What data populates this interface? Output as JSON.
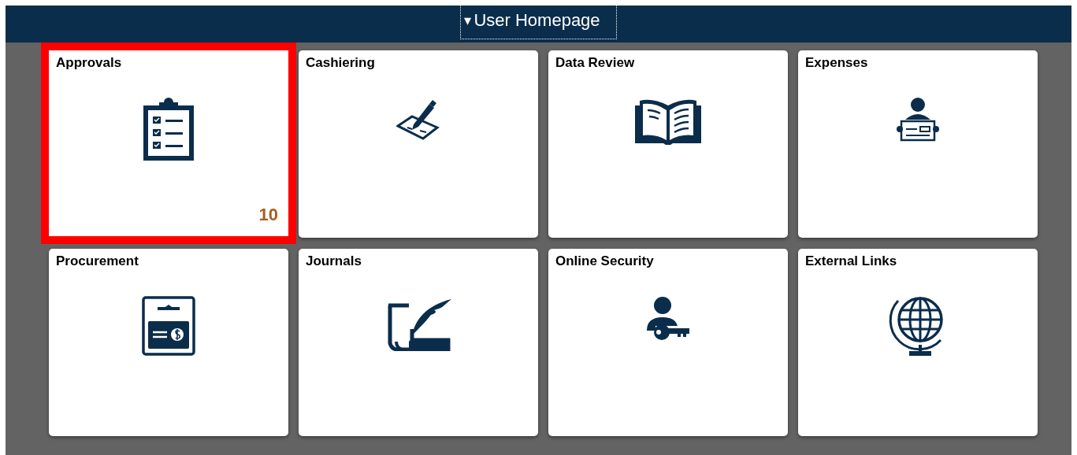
{
  "header": {
    "title": "User Homepage",
    "caret": "▾"
  },
  "tiles": [
    {
      "title": "Approvals",
      "kind": "clipboard",
      "badge": "10",
      "highlighted": true
    },
    {
      "title": "Cashiering",
      "kind": "signing",
      "highlighted": false
    },
    {
      "title": "Data Review",
      "kind": "book",
      "highlighted": false
    },
    {
      "title": "Expenses",
      "kind": "expense",
      "highlighted": false
    },
    {
      "title": "Procurement",
      "kind": "payment",
      "highlighted": false
    },
    {
      "title": "Journals",
      "kind": "quill",
      "highlighted": false
    },
    {
      "title": "Online Security",
      "kind": "security",
      "highlighted": false
    },
    {
      "title": "External Links",
      "kind": "globe",
      "highlighted": false
    }
  ]
}
